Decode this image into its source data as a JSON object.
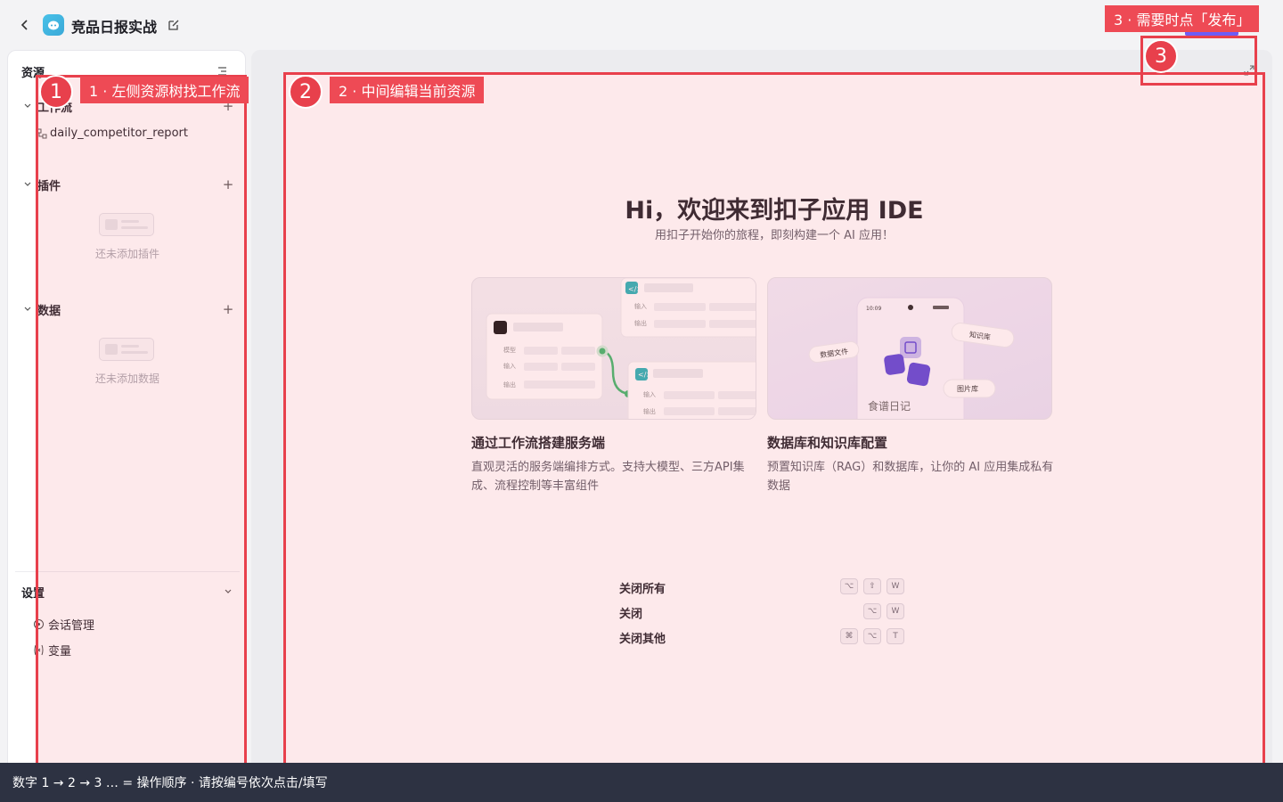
{
  "header": {
    "title": "竞品日报实战"
  },
  "sidebar": {
    "heading": "资源",
    "workflow_section": "工作流",
    "workflow_item": "daily_competitor_report",
    "plugin_section": "插件",
    "plugin_empty": "还未添加插件",
    "data_section": "数据",
    "data_empty": "还未添加数据",
    "settings_heading": "设置",
    "settings_items": [
      "会话管理",
      "变量"
    ]
  },
  "main": {
    "welcome_title": "Hi，欢迎来到扣子应用 IDE",
    "welcome_subtitle": "用扣子开始你的旅程，即刻构建一个 AI 应用！",
    "cards": [
      {
        "title": "通过工作流搭建服务端",
        "desc": "直观灵活的服务端编排方式。支持大模型、三方API集成、流程控制等丰富组件",
        "illustration_labels": [
          "输入",
          "输出",
          "模型",
          "输入",
          "输出",
          "输入",
          "输出"
        ]
      },
      {
        "title": "数据库和知识库配置",
        "desc": "预置知识库（RAG）和数据库，让你的 AI 应用集成私有数据",
        "illustration_labels": {
          "time": "10:09",
          "data_file": "数据文件",
          "knowledge": "知识库",
          "image_lib": "图片库",
          "app_name": "食谱日记"
        }
      }
    ],
    "shortcuts": [
      {
        "label": "关闭所有",
        "keys": [
          "⌥",
          "⇧",
          "W"
        ]
      },
      {
        "label": "关闭",
        "keys": [
          "⌥",
          "W"
        ]
      },
      {
        "label": "关闭其他",
        "keys": [
          "⌘",
          "⌥",
          "T"
        ]
      }
    ]
  },
  "annotations": {
    "step1_num": "1",
    "step1_label": "1 ·  左侧资源树找工作流",
    "step2_num": "2",
    "step2_label": "2 ·  中间编辑当前资源",
    "step3_num": "3",
    "step3_label": "3 ·  需要时点「发布」",
    "footer": "数字 1 → 2 → 3 … = 操作顺序 ·  请按编号依次点击/填写",
    "color": "#e8404c"
  }
}
